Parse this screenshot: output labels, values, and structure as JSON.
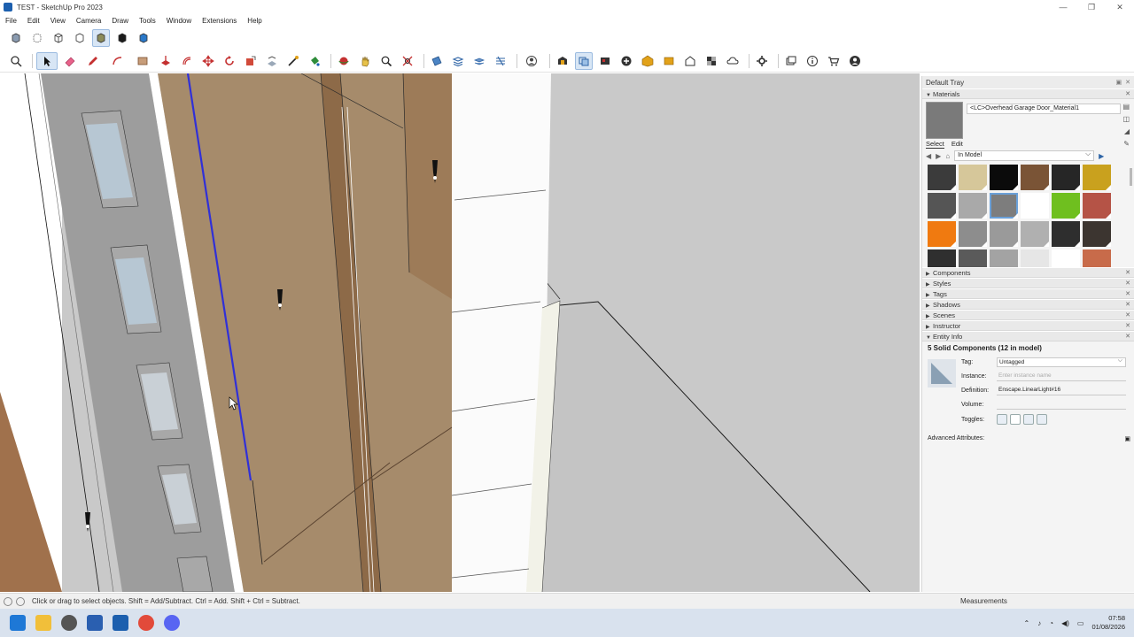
{
  "window": {
    "title": "TEST - SketchUp Pro 2023",
    "controls": [
      "—",
      "❐",
      "✕"
    ]
  },
  "menu": [
    "File",
    "Edit",
    "View",
    "Camera",
    "Draw",
    "Tools",
    "Window",
    "Extensions",
    "Help"
  ],
  "tray": {
    "title": "Default Tray",
    "materials": {
      "header": "Materials",
      "current_material": "<LC>Overhead Garage Door_Material1",
      "tabs": [
        "Select",
        "Edit"
      ],
      "library": "In Model",
      "swatch_colors": [
        "#3b3b3b",
        "#d6c79a",
        "#0b0b0b",
        "#7a5436",
        "#262626",
        "#c9a11e",
        "#555555",
        "#a9a9a9",
        "#7d7d7d",
        "#ffffff",
        "#6fbf1f",
        "#b55346",
        "#f07a10",
        "#8d8d8d",
        "#9a9a9a",
        "#b0b0b0",
        "#2e2e2e",
        "#3c3530",
        "#2f2f2f",
        "#5a5a5a",
        "#a3a3a3",
        "#e6e6e6",
        "#ffffff",
        "#c86b4a"
      ],
      "selected_index": 8
    },
    "panels": [
      "Components",
      "Styles",
      "Tags",
      "Shadows",
      "Scenes",
      "Instructor",
      "Entity Info"
    ],
    "entity_info": {
      "title": "5 Solid Components (12 in model)",
      "tag_label": "Tag:",
      "tag_value": "Untagged",
      "instance_label": "Instance:",
      "instance_placeholder": "Enter instance name",
      "definition_label": "Definition:",
      "definition_value": "Enscape.LinearLight#16",
      "volume_label": "Volume:",
      "toggles_label": "Toggles:",
      "advanced_label": "Advanced Attributes:"
    }
  },
  "status": {
    "text": "Click or drag to select objects. Shift = Add/Subtract. Ctrl = Add. Shift + Ctrl = Subtract.",
    "measurements_label": "Measurements"
  },
  "taskbar": {
    "time": "07:58",
    "date": "01/08/2026"
  },
  "colors": {
    "viewport_bg": "#c9c9c9",
    "wood": "#a68b6b",
    "wood_dark": "#8d6a48",
    "facade_gray": "#9d9d9d",
    "selection_blue": "#3030d8",
    "window_blue": "#b7c7d3"
  }
}
